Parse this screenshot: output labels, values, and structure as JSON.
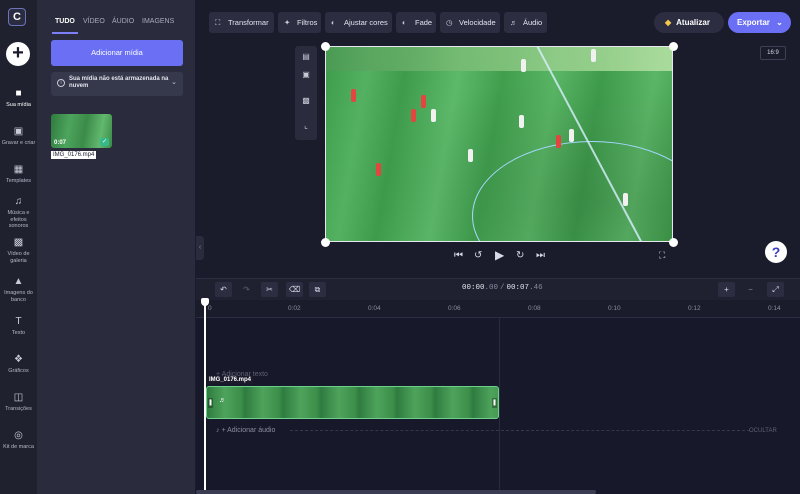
{
  "rail": {
    "items": [
      {
        "label": "Sua mídia",
        "icon": "folder-icon"
      },
      {
        "label": "Gravar e criar",
        "icon": "camera-icon"
      },
      {
        "label": "Templates",
        "icon": "grid-icon"
      },
      {
        "label": "Música e efeitos sonoros",
        "icon": "music-icon"
      },
      {
        "label": "Vídeo de galeria",
        "icon": "film-icon"
      },
      {
        "label": "Imagens do banco",
        "icon": "image-icon"
      },
      {
        "label": "Texto",
        "icon": "text-icon"
      },
      {
        "label": "Gráficos",
        "icon": "shapes-icon"
      },
      {
        "label": "Transições",
        "icon": "transition-icon"
      },
      {
        "label": "Kit de marca",
        "icon": "brand-kit-icon"
      }
    ]
  },
  "panel": {
    "tabs": [
      "TUDO",
      "VÍDEO",
      "ÁUDIO",
      "IMAGENS"
    ],
    "add_media": "Adicionar mídia",
    "notice": "Sua mídia não está armazenada na nuvem",
    "media": {
      "duration": "0:07",
      "name": "IMG_0176.mp4"
    }
  },
  "toolbar": {
    "items": [
      "Transformar",
      "Filtros",
      "Ajustar cores",
      "Fade",
      "Velocidade",
      "Áudio"
    ],
    "upgrade": "Atualizar",
    "export": "Exportar"
  },
  "preview": {
    "aspect_ratio": "16:9"
  },
  "timeline": {
    "current": "00:00",
    "current_frac": ".00",
    "total": "00:07",
    "total_frac": ".46",
    "ticks": [
      "0",
      "0:02",
      "0:04",
      "0:06",
      "0:08",
      "0:10",
      "0:12",
      "0:14"
    ],
    "add_text": "+ Adicionar texto",
    "add_audio": "+ Adicionar áudio",
    "hide": "OCULTAR",
    "clip_name": "IMG_0176.mp4"
  },
  "help": "?",
  "colors": {
    "accent": "#6a6ff3",
    "clip_border": "#6ad08b",
    "upgrade_icon": "#f2c94c"
  }
}
